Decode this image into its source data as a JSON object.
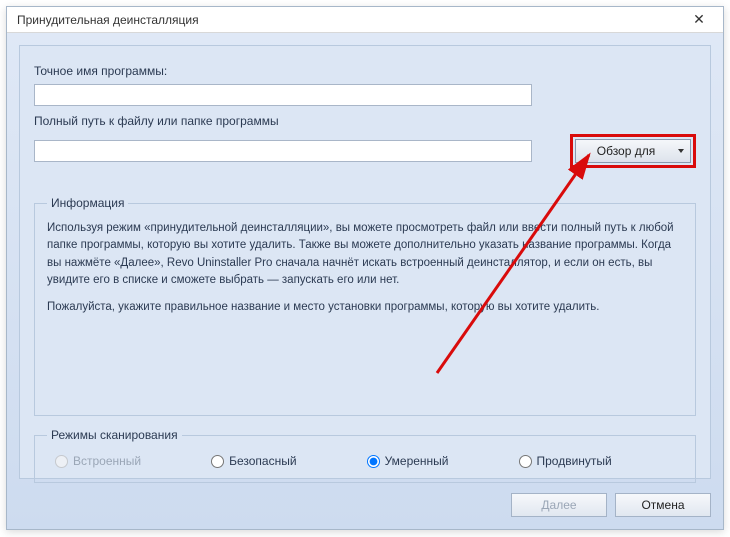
{
  "window": {
    "title": "Принудительная деинсталляция"
  },
  "fields": {
    "program_name_label": "Точное имя программы:",
    "program_name_value": "",
    "path_label": "Полный путь к файлу или папке программы",
    "path_value": "",
    "browse_label": "Обзор для"
  },
  "info": {
    "legend": "Информация",
    "p1": "Используя режим «принудительной деинсталляции», вы можете просмотреть файл или ввести полный путь к любой папке программы, которую вы хотите удалить. Также вы можете дополнительно указать название программы. Когда вы нажмёте «Далее», Revo Uninstaller Pro сначала начнёт искать встроенный деинсталлятор, и если он есть, вы увидите его в списке и сможете выбрать — запускать его или нет.",
    "p2": "Пожалуйста, укажите правильное название и место установки программы, которую вы хотите удалить."
  },
  "scan": {
    "legend": "Режимы сканирования",
    "options": {
      "builtin": "Встроенный",
      "safe": "Безопасный",
      "moderate": "Умеренный",
      "advanced": "Продвинутый"
    },
    "selected": "moderate"
  },
  "footer": {
    "next": "Далее",
    "cancel": "Отмена"
  }
}
